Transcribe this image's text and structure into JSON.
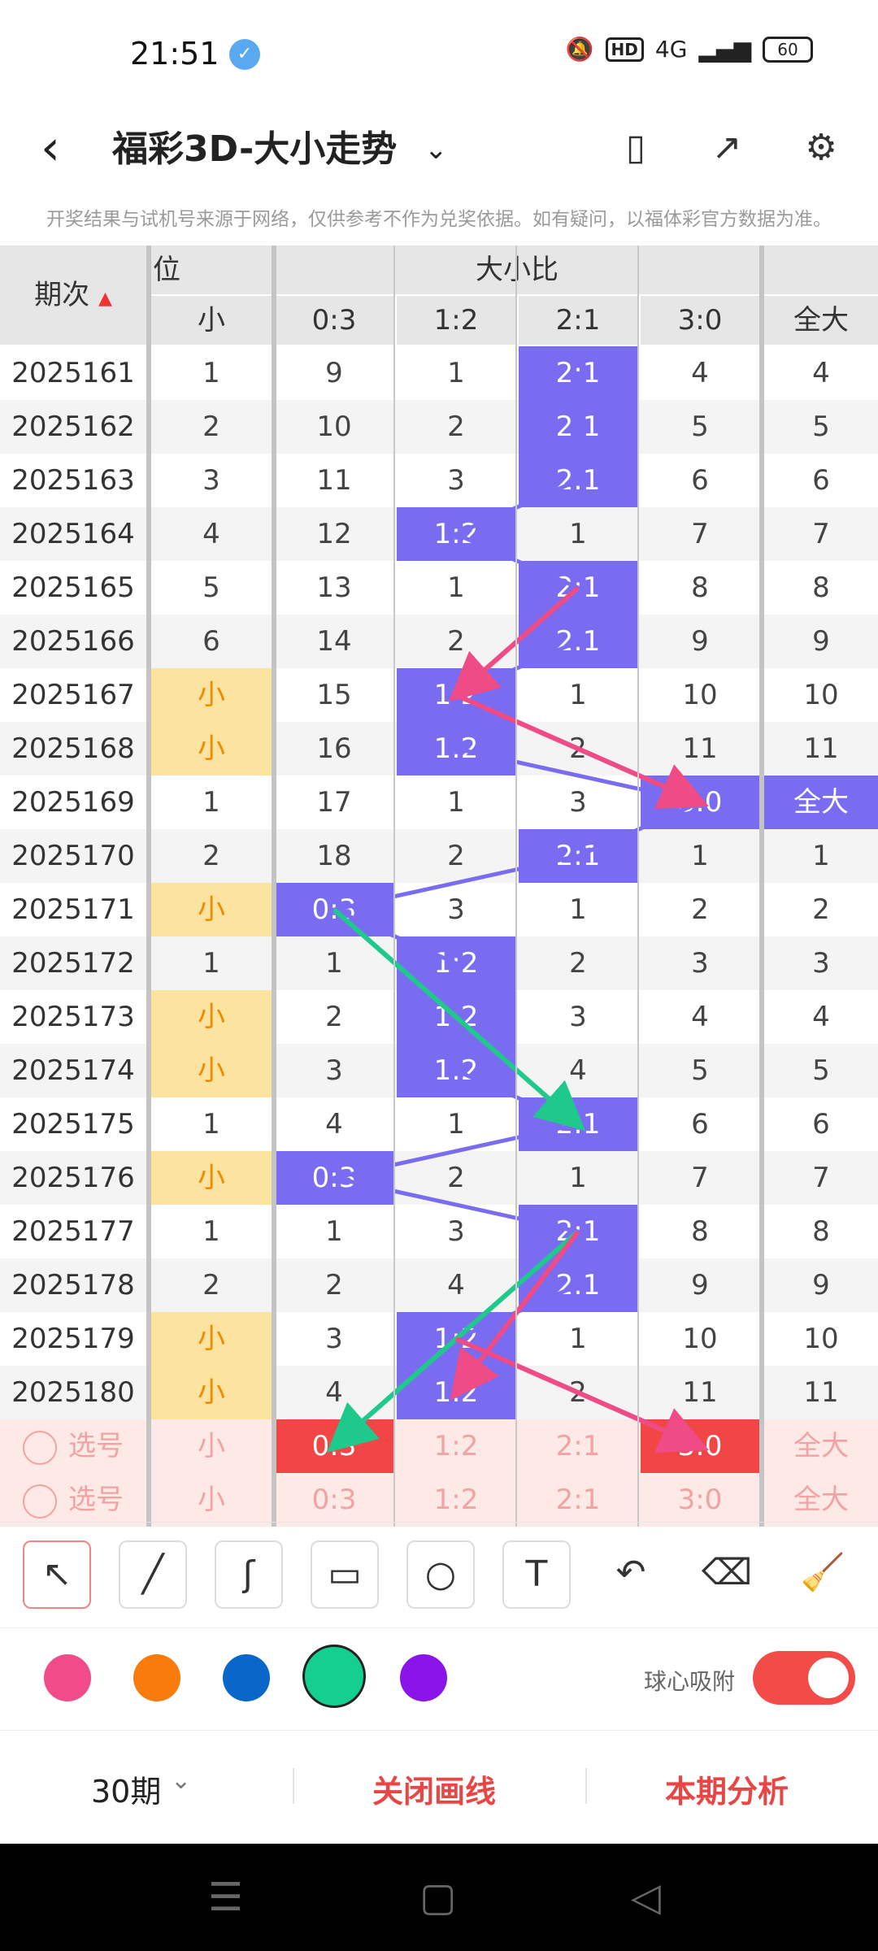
{
  "status": {
    "time": "21:51",
    "network": "4G",
    "battery": "60"
  },
  "header": {
    "title": "福彩3D-大小走势"
  },
  "notice": "开奖结果与试机号来源于网络，仅供参考不作为兑奖依据。如有疑问，以福体彩官方数据为准。",
  "table": {
    "col_issue": "期次",
    "group_pos": "位",
    "group_ratio": "大小比",
    "headers": [
      "小",
      "0:3",
      "1:2",
      "2:1",
      "3:0",
      "全大"
    ],
    "rows": [
      {
        "issue": "2025161",
        "c": [
          "1",
          "9",
          "1",
          "2:1",
          "4",
          "4"
        ]
      },
      {
        "issue": "2025162",
        "c": [
          "2",
          "10",
          "2",
          "2:1",
          "5",
          "5"
        ]
      },
      {
        "issue": "2025163",
        "c": [
          "3",
          "11",
          "3",
          "2:1",
          "6",
          "6"
        ]
      },
      {
        "issue": "2025164",
        "c": [
          "4",
          "12",
          "1:2",
          "1",
          "7",
          "7"
        ]
      },
      {
        "issue": "2025165",
        "c": [
          "5",
          "13",
          "1",
          "2:1",
          "8",
          "8"
        ]
      },
      {
        "issue": "2025166",
        "c": [
          "6",
          "14",
          "2",
          "2:1",
          "9",
          "9"
        ]
      },
      {
        "issue": "2025167",
        "c": [
          "小",
          "15",
          "1:2",
          "1",
          "10",
          "10"
        ]
      },
      {
        "issue": "2025168",
        "c": [
          "小",
          "16",
          "1:2",
          "2",
          "11",
          "11"
        ]
      },
      {
        "issue": "2025169",
        "c": [
          "1",
          "17",
          "1",
          "3",
          "3:0",
          "全大"
        ]
      },
      {
        "issue": "2025170",
        "c": [
          "2",
          "18",
          "2",
          "2:1",
          "1",
          "1"
        ]
      },
      {
        "issue": "2025171",
        "c": [
          "小",
          "0:3",
          "3",
          "1",
          "2",
          "2"
        ]
      },
      {
        "issue": "2025172",
        "c": [
          "1",
          "1",
          "1:2",
          "2",
          "3",
          "3"
        ]
      },
      {
        "issue": "2025173",
        "c": [
          "小",
          "2",
          "1:2",
          "3",
          "4",
          "4"
        ]
      },
      {
        "issue": "2025174",
        "c": [
          "小",
          "3",
          "1:2",
          "4",
          "5",
          "5"
        ]
      },
      {
        "issue": "2025175",
        "c": [
          "1",
          "4",
          "1",
          "2:1",
          "6",
          "6"
        ]
      },
      {
        "issue": "2025176",
        "c": [
          "小",
          "0:3",
          "2",
          "1",
          "7",
          "7"
        ]
      },
      {
        "issue": "2025177",
        "c": [
          "1",
          "1",
          "3",
          "2:1",
          "8",
          "8"
        ]
      },
      {
        "issue": "2025178",
        "c": [
          "2",
          "2",
          "4",
          "2:1",
          "9",
          "9"
        ]
      },
      {
        "issue": "2025179",
        "c": [
          "小",
          "3",
          "1:2",
          "1",
          "10",
          "10"
        ]
      },
      {
        "issue": "2025180",
        "c": [
          "小",
          "4",
          "1:2",
          "2",
          "11",
          "11"
        ]
      }
    ],
    "select_rows": [
      {
        "label": "选号",
        "c": [
          "小",
          "0:3",
          "1:2",
          "2:1",
          "3:0",
          "全大"
        ]
      },
      {
        "label": "选号",
        "c": [
          "小",
          "0:3",
          "1:2",
          "2:1",
          "3:0",
          "全大"
        ]
      }
    ]
  },
  "colors": {
    "highlight_purple": "#7a6cf0",
    "highlight_yellow": "#fde3a0",
    "highlight_red": "#f24646",
    "arrow_pink": "#ef4b86",
    "arrow_green": "#1ec98b",
    "swatches": [
      "#f24b8a",
      "#f97b0c",
      "#0a66c9",
      "#14cf8f",
      "#8a14ea"
    ]
  },
  "toolbar": {
    "tools": [
      "cursor-arrow",
      "line",
      "freehand",
      "rectangle",
      "circle",
      "text",
      "undo",
      "eraser",
      "clear-brush"
    ]
  },
  "snap": {
    "label": "球心吸附",
    "on": true
  },
  "bottom": {
    "period": "30期",
    "close_draw": "关闭画线",
    "analysis": "本期分析"
  }
}
